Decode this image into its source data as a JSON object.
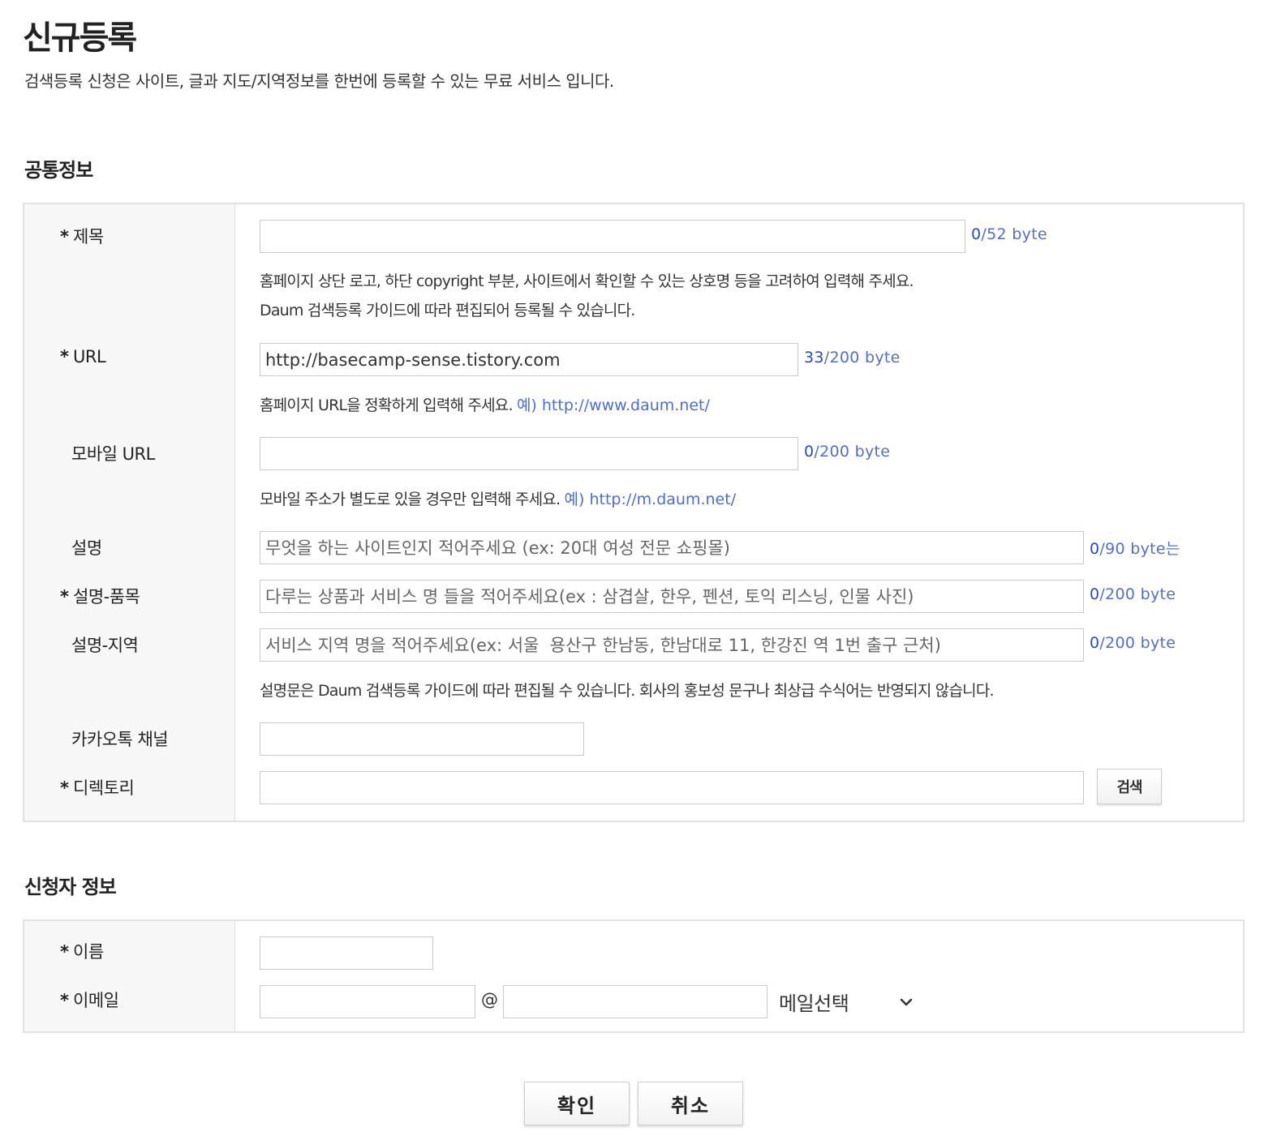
{
  "page": {
    "title": "신규등록",
    "description": "검색등록 신청은 사이트, 글과 지도/지역정보를 한번에 등록할 수 있는 무료 서비스 입니다."
  },
  "common": {
    "section_title": "공통정보",
    "required_mark": "*",
    "title_field": {
      "label": "제목",
      "value": "",
      "count": "0",
      "limit": "/52 byte",
      "help1": "홈페이지 상단 로고, 하단 copyright 부분, 사이트에서 확인할 수 있는 상호명 등을 고려하여 입력해 주세요.",
      "help2": "Daum 검색등록 가이드에 따라 편집되어 등록될 수 있습니다."
    },
    "url_field": {
      "label": "URL",
      "value": "http://basecamp-sense.tistory.com",
      "count": "33",
      "limit": "/200 byte",
      "help": "홈페이지 URL을 정확하게 입력해 주세요.",
      "example": "예) http://www.daum.net/"
    },
    "mobile_url_field": {
      "label": "모바일 URL",
      "value": "",
      "count": "0",
      "limit": "/200 byte",
      "help": "모바일 주소가 별도로 있을 경우만 입력해 주세요.",
      "example": "예) http://m.daum.net/"
    },
    "desc_field": {
      "label": "설명",
      "placeholder": "무엇을 하는 사이트인지 적어주세요 (ex: 20대 여성 전문 쇼핑몰)",
      "count": "0",
      "limit": "/90 byte는"
    },
    "desc_item_field": {
      "label": "설명-품목",
      "placeholder": "다루는 상품과 서비스 명 들을 적어주세요(ex : 삼겹살, 한우, 펜션, 토익 리스닝, 인물 사진)",
      "count": "0",
      "limit": "/200 byte"
    },
    "desc_region_field": {
      "label": "설명-지역",
      "placeholder": "서비스 지역 명을 적어주세요(ex: 서울  용산구 한남동, 한남대로 11, 한강진 역 1번 출구 근처)",
      "count": "0",
      "limit": "/200 byte",
      "help": "설명문은 Daum 검색등록 가이드에 따라 편집될 수 있습니다. 회사의 홍보성 문구나 최상급 수식어는 반영되지 않습니다."
    },
    "kakao_field": {
      "label": "카카오톡 채널",
      "value": ""
    },
    "directory_field": {
      "label": "디렉토리",
      "value": "",
      "search_label": "검색"
    }
  },
  "applicant": {
    "section_title": "신청자 정보",
    "name_field": {
      "label": "이름",
      "value": ""
    },
    "email_field": {
      "label": "이메일",
      "at": "@",
      "select_label": "메일선택"
    }
  },
  "actions": {
    "confirm_label": "확인",
    "cancel_label": "취소"
  }
}
